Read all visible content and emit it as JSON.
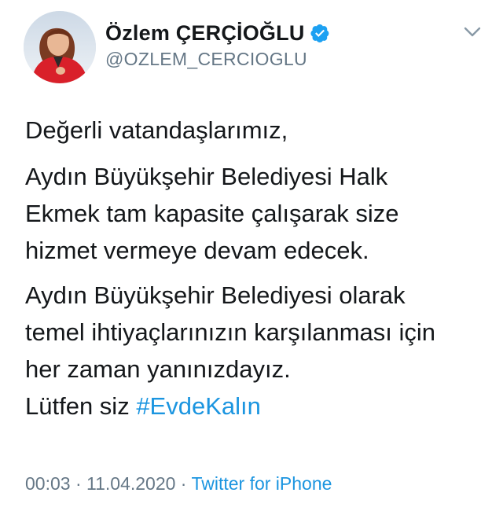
{
  "author": {
    "display_name": "Özlem ÇERÇİOĞLU",
    "handle": "@OZLEM_CERCIOGLU",
    "verified": true,
    "verified_color": "#1da1f2"
  },
  "tweet": {
    "greeting": "Değerli vatandaşlarımız,",
    "p2_lines": [
      "Aydın Büyükşehir Belediyesi Halk",
      "Ekmek tam kapasite çalışarak size",
      "hizmet vermeye devam edecek."
    ],
    "p3_lines": [
      "Aydın Büyükşehir Belediyesi olarak",
      "temel ihtiyaçlarınızın karşılanması için",
      "her zaman yanınızdayız."
    ],
    "closing_prefix": "Lütfen siz ",
    "hashtag": "#EvdeKalın",
    "link_color": "#1b95e0"
  },
  "meta": {
    "time": "00:03",
    "separator": " · ",
    "date": "11.04.2020",
    "separator2": " · ",
    "source": "Twitter for iPhone"
  },
  "icons": {
    "menu": "chevron-down-icon",
    "verified": "verified-badge-icon"
  }
}
